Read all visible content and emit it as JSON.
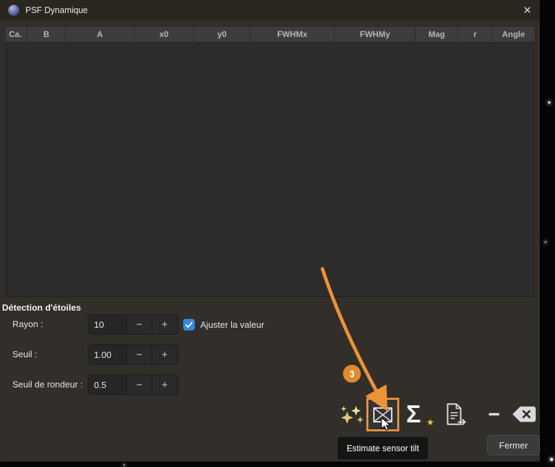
{
  "window": {
    "title": "PSF Dynamique"
  },
  "icons": {
    "close": "✕",
    "spin_minus": "−",
    "spin_plus": "+",
    "toolbar_minus": "−",
    "sigma": "Σ",
    "sigma_star": "★"
  },
  "table": {
    "columns": [
      "Ca.",
      "B",
      "A",
      "x0",
      "y0",
      "FWHMx",
      "FWHMy",
      "Mag",
      "r",
      "Angle"
    ]
  },
  "detection": {
    "section_title": "Détection d'étoiles",
    "rows": [
      {
        "label": "Rayon :",
        "value": "10"
      },
      {
        "label": "Seuil :",
        "value": "1.00"
      },
      {
        "label": "Seuil de rondeur :",
        "value": "0.5"
      }
    ],
    "adjust_checkbox_label": "Ajuster la valeur"
  },
  "annotation": {
    "badge": "3"
  },
  "toolbar": {
    "tooltip": "Estimate sensor tilt"
  },
  "footer": {
    "close_button": "Fermer"
  },
  "colors": {
    "accent_orange": "#e8913a",
    "checkbox_blue": "#3584e4"
  }
}
